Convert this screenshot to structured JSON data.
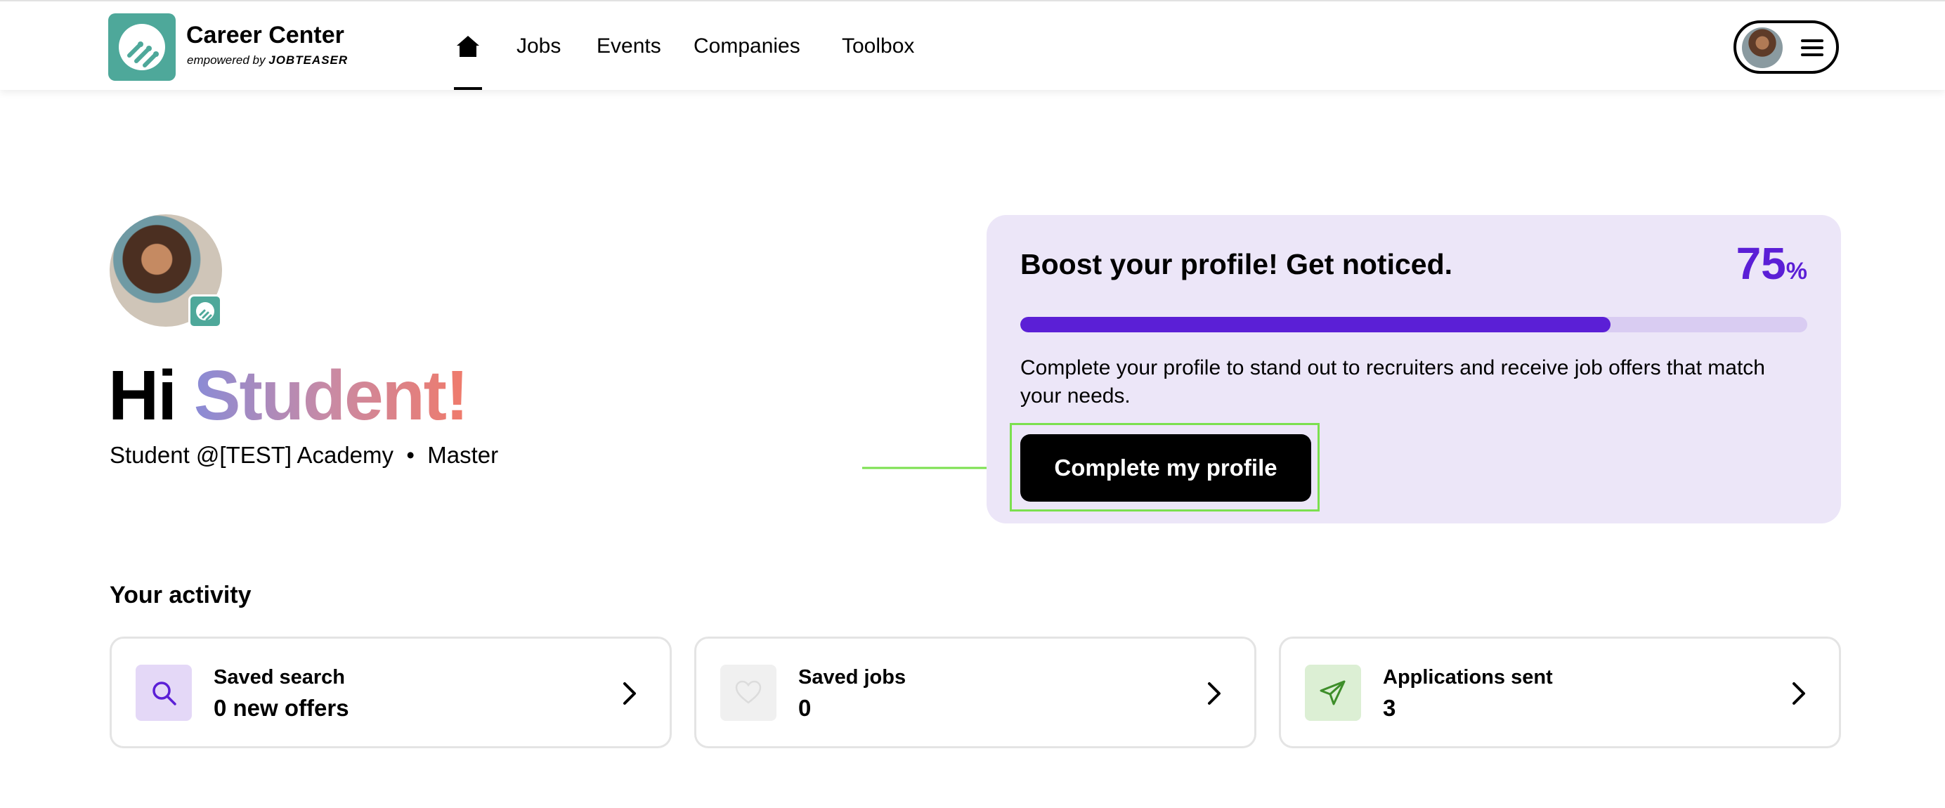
{
  "colors": {
    "brand_teal": "#4ea89a",
    "accent_purple": "#5b1fd6",
    "card_lavender": "#ece6f8",
    "highlight_green": "#7be04f"
  },
  "header": {
    "brand_title": "Career Center",
    "brand_sub_prefix": "empowered by",
    "brand_sub_name": "JOBTEASER",
    "nav": {
      "home_icon": "home-icon",
      "items": [
        "Jobs",
        "Events",
        "Companies",
        "Toolbox"
      ]
    },
    "menu_icon": "hamburger-menu-icon"
  },
  "hero": {
    "greeting": "Hi",
    "name": "Student!",
    "subtitle": "Student @[TEST] Academy  •  Master"
  },
  "boost": {
    "title": "Boost your profile! Get noticed.",
    "percent_value": "75",
    "percent_sign": "%",
    "progress": 0.75,
    "description": "Complete your profile to stand out to recruiters and receive job offers that match your needs.",
    "cta_label": "Complete my profile"
  },
  "activity": {
    "title": "Your activity",
    "cards": [
      {
        "icon": "search-icon",
        "label": "Saved search",
        "value": "0 new offers",
        "icon_bg": "#e4d8f7",
        "icon_color": "#5b1fd6"
      },
      {
        "icon": "heart-icon",
        "label": "Saved jobs",
        "value": "0",
        "icon_bg": "#f0f0f0",
        "icon_color": "#dcdcdc"
      },
      {
        "icon": "send-icon",
        "label": "Applications sent",
        "value": "3",
        "icon_bg": "#dcefd4",
        "icon_color": "#3e8e2a"
      }
    ]
  }
}
